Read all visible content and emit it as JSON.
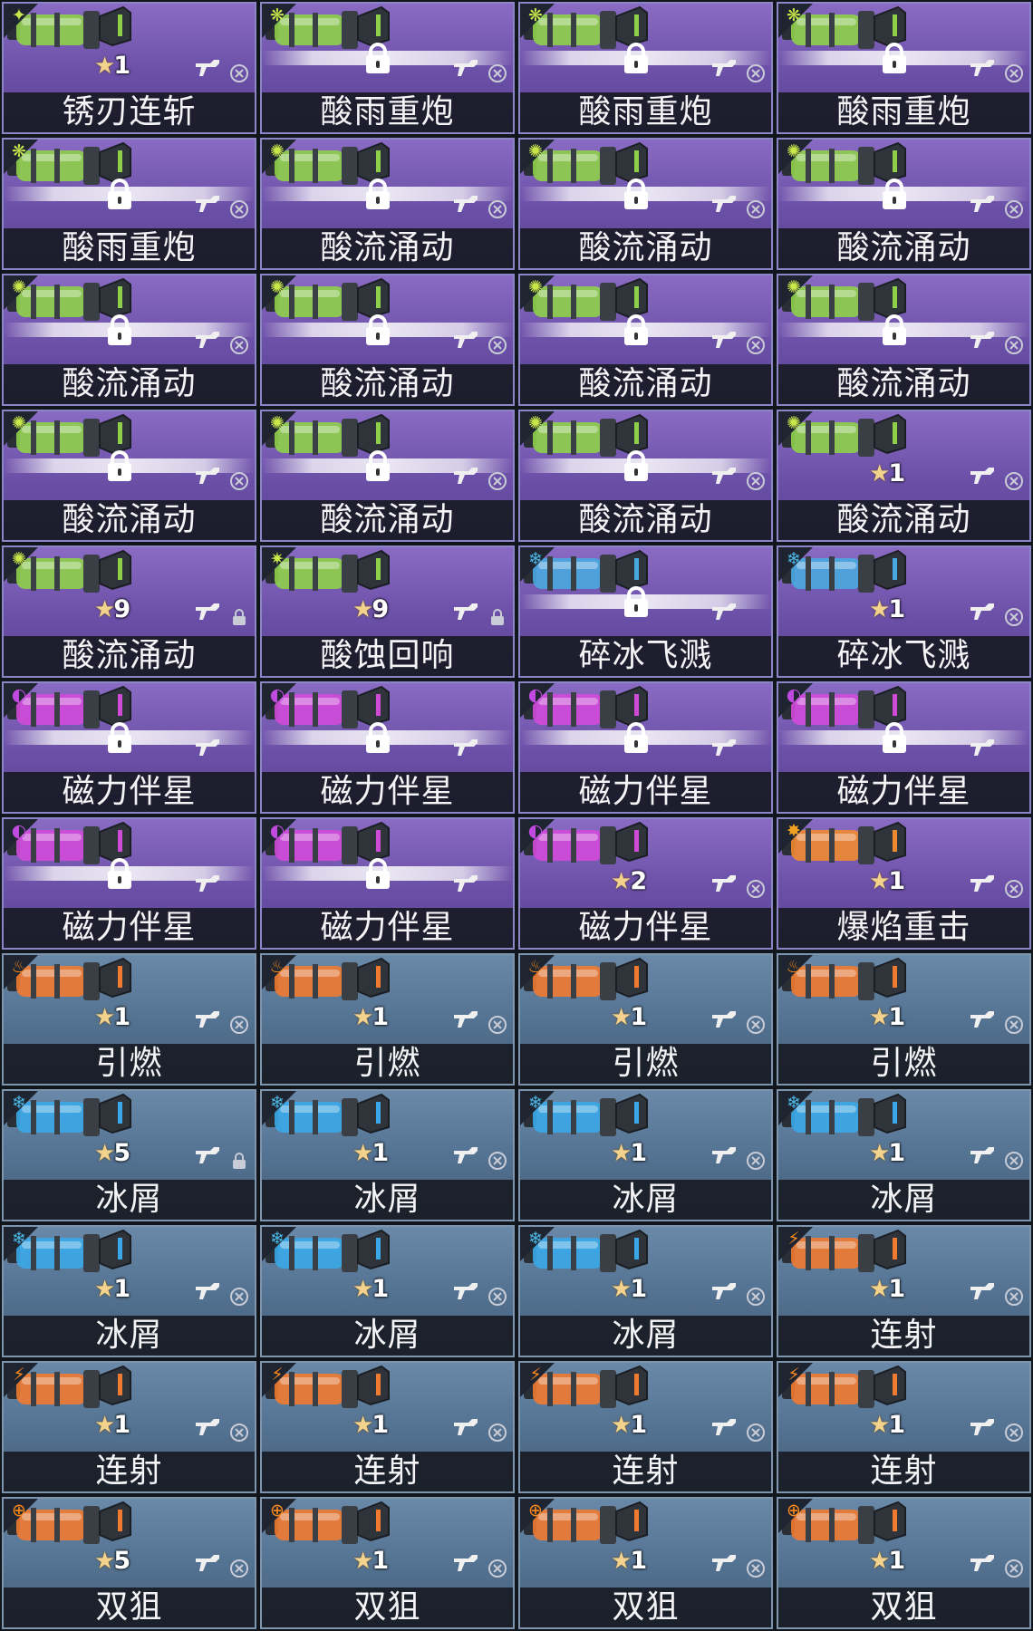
{
  "columns": 4,
  "cards": [
    {
      "name": "锈刃连斩",
      "theme": "purple",
      "element": "blade-burst",
      "element_glyph": "✦",
      "element_color": "#c8e84a",
      "canister_color": "#8fd04a",
      "locked": false,
      "stars": "1",
      "status": "dismiss-icon"
    },
    {
      "name": "酸雨重炮",
      "theme": "purple",
      "element": "acid-splash",
      "element_glyph": "❋",
      "element_color": "#c8e84a",
      "canister_color": "#8fd04a",
      "locked": true,
      "stars": "",
      "status": "dismiss-icon"
    },
    {
      "name": "酸雨重炮",
      "theme": "purple",
      "element": "acid-splash",
      "element_glyph": "❋",
      "element_color": "#c8e84a",
      "canister_color": "#8fd04a",
      "locked": true,
      "stars": "",
      "status": "dismiss-icon"
    },
    {
      "name": "酸雨重炮",
      "theme": "purple",
      "element": "acid-splash",
      "element_glyph": "❋",
      "element_color": "#c8e84a",
      "canister_color": "#8fd04a",
      "locked": true,
      "stars": "",
      "status": "dismiss-icon"
    },
    {
      "name": "酸雨重炮",
      "theme": "purple",
      "element": "acid-splash",
      "element_glyph": "❋",
      "element_color": "#c8e84a",
      "canister_color": "#8fd04a",
      "locked": true,
      "stars": "",
      "status": "dismiss-icon"
    },
    {
      "name": "酸流涌动",
      "theme": "purple",
      "element": "acid-drip",
      "element_glyph": "✺",
      "element_color": "#c8e84a",
      "canister_color": "#8fd04a",
      "locked": true,
      "stars": "",
      "status": "dismiss-icon"
    },
    {
      "name": "酸流涌动",
      "theme": "purple",
      "element": "acid-drip",
      "element_glyph": "✺",
      "element_color": "#c8e84a",
      "canister_color": "#8fd04a",
      "locked": true,
      "stars": "",
      "status": "dismiss-icon"
    },
    {
      "name": "酸流涌动",
      "theme": "purple",
      "element": "acid-drip",
      "element_glyph": "✺",
      "element_color": "#c8e84a",
      "canister_color": "#8fd04a",
      "locked": true,
      "stars": "",
      "status": "dismiss-icon"
    },
    {
      "name": "酸流涌动",
      "theme": "purple",
      "element": "acid-drip",
      "element_glyph": "✺",
      "element_color": "#c8e84a",
      "canister_color": "#8fd04a",
      "locked": true,
      "stars": "",
      "status": "dismiss-icon"
    },
    {
      "name": "酸流涌动",
      "theme": "purple",
      "element": "acid-drip",
      "element_glyph": "✺",
      "element_color": "#c8e84a",
      "canister_color": "#8fd04a",
      "locked": true,
      "stars": "",
      "status": "dismiss-icon"
    },
    {
      "name": "酸流涌动",
      "theme": "purple",
      "element": "acid-drip",
      "element_glyph": "✺",
      "element_color": "#c8e84a",
      "canister_color": "#8fd04a",
      "locked": true,
      "stars": "",
      "status": "dismiss-icon"
    },
    {
      "name": "酸流涌动",
      "theme": "purple",
      "element": "acid-drip",
      "element_glyph": "✺",
      "element_color": "#c8e84a",
      "canister_color": "#8fd04a",
      "locked": true,
      "stars": "",
      "status": "dismiss-icon"
    },
    {
      "name": "酸流涌动",
      "theme": "purple",
      "element": "acid-drip",
      "element_glyph": "✺",
      "element_color": "#c8e84a",
      "canister_color": "#8fd04a",
      "locked": true,
      "stars": "",
      "status": "dismiss-icon"
    },
    {
      "name": "酸流涌动",
      "theme": "purple",
      "element": "acid-drip",
      "element_glyph": "✺",
      "element_color": "#c8e84a",
      "canister_color": "#8fd04a",
      "locked": true,
      "stars": "",
      "status": "dismiss-icon"
    },
    {
      "name": "酸流涌动",
      "theme": "purple",
      "element": "acid-drip",
      "element_glyph": "✺",
      "element_color": "#c8e84a",
      "canister_color": "#8fd04a",
      "locked": true,
      "stars": "",
      "status": "dismiss-icon"
    },
    {
      "name": "酸流涌动",
      "theme": "purple",
      "element": "acid-drip",
      "element_glyph": "✺",
      "element_color": "#c8e84a",
      "canister_color": "#8fd04a",
      "locked": false,
      "stars": "1",
      "status": "dismiss-icon"
    },
    {
      "name": "酸流涌动",
      "theme": "purple",
      "element": "acid-drip",
      "element_glyph": "✺",
      "element_color": "#c8e84a",
      "canister_color": "#8fd04a",
      "locked": false,
      "stars": "9",
      "status": "lock-badge-icon"
    },
    {
      "name": "酸蚀回响",
      "theme": "purple",
      "element": "acid-echo",
      "element_glyph": "✷",
      "element_color": "#c8e84a",
      "canister_color": "#8fd04a",
      "locked": false,
      "stars": "9",
      "status": "lock-badge-icon"
    },
    {
      "name": "碎冰飞溅",
      "theme": "purple",
      "element": "ice-shatter",
      "element_glyph": "❄",
      "element_color": "#4ab8e8",
      "canister_color": "#4aa8e0",
      "locked": true,
      "stars": "",
      "status": "none"
    },
    {
      "name": "碎冰飞溅",
      "theme": "purple",
      "element": "ice-shatter",
      "element_glyph": "❄",
      "element_color": "#4ab8e8",
      "canister_color": "#4aa8e0",
      "locked": false,
      "stars": "1",
      "status": "dismiss-icon"
    },
    {
      "name": "磁力伴星",
      "theme": "purple",
      "element": "magnet-orbit",
      "element_glyph": "◐",
      "element_color": "#c04ae0",
      "canister_color": "#d04ad8",
      "locked": true,
      "stars": "",
      "status": "none"
    },
    {
      "name": "磁力伴星",
      "theme": "purple",
      "element": "magnet-orbit",
      "element_glyph": "◐",
      "element_color": "#c04ae0",
      "canister_color": "#d04ad8",
      "locked": true,
      "stars": "",
      "status": "none"
    },
    {
      "name": "磁力伴星",
      "theme": "purple",
      "element": "magnet-orbit",
      "element_glyph": "◐",
      "element_color": "#c04ae0",
      "canister_color": "#d04ad8",
      "locked": true,
      "stars": "",
      "status": "none"
    },
    {
      "name": "磁力伴星",
      "theme": "purple",
      "element": "magnet-orbit",
      "element_glyph": "◐",
      "element_color": "#c04ae0",
      "canister_color": "#d04ad8",
      "locked": true,
      "stars": "",
      "status": "none"
    },
    {
      "name": "磁力伴星",
      "theme": "purple",
      "element": "magnet-orbit",
      "element_glyph": "◐",
      "element_color": "#c04ae0",
      "canister_color": "#d04ad8",
      "locked": true,
      "stars": "",
      "status": "none"
    },
    {
      "name": "磁力伴星",
      "theme": "purple",
      "element": "magnet-orbit",
      "element_glyph": "◐",
      "element_color": "#c04ae0",
      "canister_color": "#d04ad8",
      "locked": true,
      "stars": "",
      "status": "none"
    },
    {
      "name": "磁力伴星",
      "theme": "purple",
      "element": "magnet-orbit",
      "element_glyph": "◐",
      "element_color": "#c04ae0",
      "canister_color": "#d04ad8",
      "locked": false,
      "stars": "2",
      "status": "dismiss-icon"
    },
    {
      "name": "爆焰重击",
      "theme": "purple",
      "element": "blast-flame",
      "element_glyph": "✸",
      "element_color": "#f0a020",
      "canister_color": "#f08a30",
      "locked": false,
      "stars": "1",
      "status": "dismiss-icon"
    },
    {
      "name": "引燃",
      "theme": "blue",
      "element": "fire",
      "element_glyph": "♨",
      "element_color": "#ff8a1a",
      "canister_color": "#f07a30",
      "locked": false,
      "stars": "1",
      "status": "dismiss-icon"
    },
    {
      "name": "引燃",
      "theme": "blue",
      "element": "fire",
      "element_glyph": "♨",
      "element_color": "#ff8a1a",
      "canister_color": "#f07a30",
      "locked": false,
      "stars": "1",
      "status": "dismiss-icon"
    },
    {
      "name": "引燃",
      "theme": "blue",
      "element": "fire",
      "element_glyph": "♨",
      "element_color": "#ff8a1a",
      "canister_color": "#f07a30",
      "locked": false,
      "stars": "1",
      "status": "dismiss-icon"
    },
    {
      "name": "引燃",
      "theme": "blue",
      "element": "fire",
      "element_glyph": "♨",
      "element_color": "#ff8a1a",
      "canister_color": "#f07a30",
      "locked": false,
      "stars": "1",
      "status": "dismiss-icon"
    },
    {
      "name": "冰屑",
      "theme": "blue",
      "element": "ice",
      "element_glyph": "❄",
      "element_color": "#4ab8e8",
      "canister_color": "#3aa8e8",
      "locked": false,
      "stars": "5",
      "status": "lock-badge-icon"
    },
    {
      "name": "冰屑",
      "theme": "blue",
      "element": "ice",
      "element_glyph": "❄",
      "element_color": "#4ab8e8",
      "canister_color": "#3aa8e8",
      "locked": false,
      "stars": "1",
      "status": "dismiss-icon"
    },
    {
      "name": "冰屑",
      "theme": "blue",
      "element": "ice",
      "element_glyph": "❄",
      "element_color": "#4ab8e8",
      "canister_color": "#3aa8e8",
      "locked": false,
      "stars": "1",
      "status": "dismiss-icon"
    },
    {
      "name": "冰屑",
      "theme": "blue",
      "element": "ice",
      "element_glyph": "❄",
      "element_color": "#4ab8e8",
      "canister_color": "#3aa8e8",
      "locked": false,
      "stars": "1",
      "status": "dismiss-icon"
    },
    {
      "name": "冰屑",
      "theme": "blue",
      "element": "ice",
      "element_glyph": "❄",
      "element_color": "#4ab8e8",
      "canister_color": "#3aa8e8",
      "locked": false,
      "stars": "1",
      "status": "dismiss-icon"
    },
    {
      "name": "冰屑",
      "theme": "blue",
      "element": "ice",
      "element_glyph": "❄",
      "element_color": "#4ab8e8",
      "canister_color": "#3aa8e8",
      "locked": false,
      "stars": "1",
      "status": "dismiss-icon"
    },
    {
      "name": "冰屑",
      "theme": "blue",
      "element": "ice",
      "element_glyph": "❄",
      "element_color": "#4ab8e8",
      "canister_color": "#3aa8e8",
      "locked": false,
      "stars": "1",
      "status": "dismiss-icon"
    },
    {
      "name": "连射",
      "theme": "blue",
      "element": "rapid-fire",
      "element_glyph": "⚡",
      "element_color": "#ff8a1a",
      "canister_color": "#f07a30",
      "locked": false,
      "stars": "1",
      "status": "dismiss-icon"
    },
    {
      "name": "连射",
      "theme": "blue",
      "element": "rapid-fire",
      "element_glyph": "⚡",
      "element_color": "#ff8a1a",
      "canister_color": "#f07a30",
      "locked": false,
      "stars": "1",
      "status": "dismiss-icon"
    },
    {
      "name": "连射",
      "theme": "blue",
      "element": "rapid-fire",
      "element_glyph": "⚡",
      "element_color": "#ff8a1a",
      "canister_color": "#f07a30",
      "locked": false,
      "stars": "1",
      "status": "dismiss-icon"
    },
    {
      "name": "连射",
      "theme": "blue",
      "element": "rapid-fire",
      "element_glyph": "⚡",
      "element_color": "#ff8a1a",
      "canister_color": "#f07a30",
      "locked": false,
      "stars": "1",
      "status": "dismiss-icon"
    },
    {
      "name": "连射",
      "theme": "blue",
      "element": "rapid-fire",
      "element_glyph": "⚡",
      "element_color": "#ff8a1a",
      "canister_color": "#f07a30",
      "locked": false,
      "stars": "1",
      "status": "dismiss-icon"
    },
    {
      "name": "双狙",
      "theme": "blue",
      "element": "crosshair",
      "element_glyph": "⊕",
      "element_color": "#ff8a1a",
      "canister_color": "#f07a30",
      "locked": false,
      "stars": "5",
      "status": "dismiss-icon"
    },
    {
      "name": "双狙",
      "theme": "blue",
      "element": "crosshair",
      "element_glyph": "⊕",
      "element_color": "#ff8a1a",
      "canister_color": "#f07a30",
      "locked": false,
      "stars": "1",
      "status": "dismiss-icon"
    },
    {
      "name": "双狙",
      "theme": "blue",
      "element": "crosshair",
      "element_glyph": "⊕",
      "element_color": "#ff8a1a",
      "canister_color": "#f07a30",
      "locked": false,
      "stars": "1",
      "status": "dismiss-icon"
    },
    {
      "name": "双狙",
      "theme": "blue",
      "element": "crosshair",
      "element_glyph": "⊕",
      "element_color": "#ff8a1a",
      "canister_color": "#f07a30",
      "locked": false,
      "stars": "1",
      "status": "dismiss-icon"
    }
  ]
}
